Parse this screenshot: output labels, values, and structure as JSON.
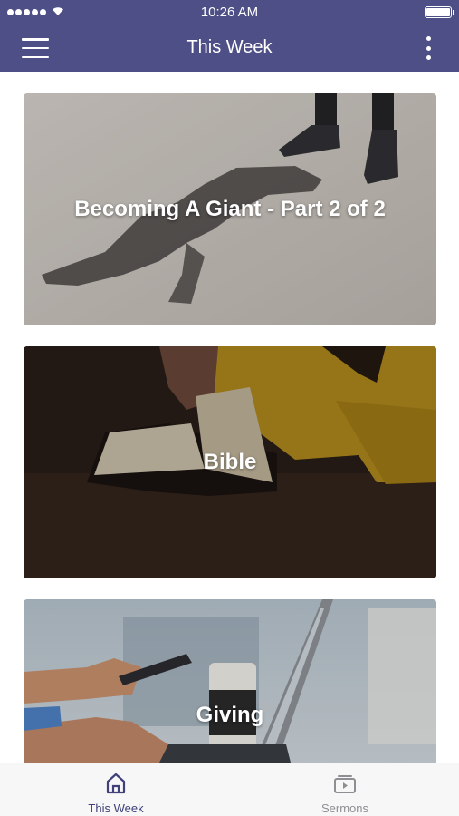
{
  "status_bar": {
    "time": "10:26 AM"
  },
  "nav": {
    "title": "This Week"
  },
  "cards": [
    {
      "title": "Becoming A Giant - Part 2 of 2"
    },
    {
      "title": "Bible"
    },
    {
      "title": "Giving"
    }
  ],
  "tabs": [
    {
      "label": "This Week",
      "icon": "home-icon",
      "active": true
    },
    {
      "label": "Sermons",
      "icon": "video-play-icon",
      "active": false
    }
  ],
  "colors": {
    "accent": "#4e4f87",
    "tab_active": "#3f4178",
    "tab_inactive": "#8e8e93"
  }
}
